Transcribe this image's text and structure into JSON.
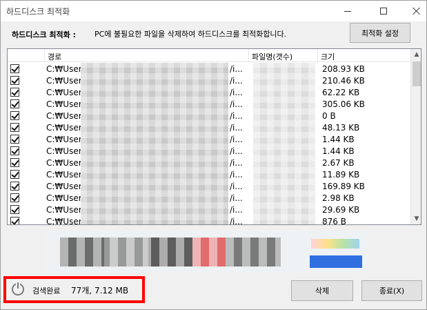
{
  "window": {
    "title": "하드디스크 최적화"
  },
  "header": {
    "label": "하드디스크 최적화 :",
    "description": "PC에 불필요한 파일을 삭제하여 하드디스크를 최적화합니다.",
    "settings_button": "최적화 설정"
  },
  "table": {
    "columns": [
      "경로",
      "파일명(갯수)",
      "크기"
    ],
    "rows": [
      {
        "checked": true,
        "path": "C:₩User",
        "frag": "/i...",
        "size": "208.93 KB"
      },
      {
        "checked": true,
        "path": "C:₩User",
        "frag": "/i...",
        "size": "210.46 KB"
      },
      {
        "checked": true,
        "path": "C:₩User",
        "frag": "/i...",
        "size": "62.22 KB"
      },
      {
        "checked": true,
        "path": "C:₩User",
        "frag": "/i...",
        "size": "305.06 KB"
      },
      {
        "checked": true,
        "path": "C:₩User",
        "frag": "/i...",
        "size": "0 B"
      },
      {
        "checked": true,
        "path": "C:₩User",
        "frag": "/i...",
        "size": "48.13 KB"
      },
      {
        "checked": true,
        "path": "C:₩User",
        "frag": "/i...",
        "size": "1.44 KB"
      },
      {
        "checked": true,
        "path": "C:₩User",
        "frag": "/i...",
        "size": "1.44 KB"
      },
      {
        "checked": true,
        "path": "C:₩User",
        "frag": "/i...",
        "size": "2.67 KB"
      },
      {
        "checked": true,
        "path": "C:₩User",
        "frag": "/i...",
        "size": "11.89 KB"
      },
      {
        "checked": true,
        "path": "C:₩User",
        "frag": "/i...",
        "size": "169.89 KB"
      },
      {
        "checked": true,
        "path": "C:₩User",
        "frag": "/i...",
        "size": "2.98 KB"
      },
      {
        "checked": true,
        "path": "C:₩User",
        "frag": "/i...",
        "size": "29.69 KB"
      },
      {
        "checked": true,
        "path": "C:₩User",
        "frag": "/i...",
        "size": "876 B"
      }
    ]
  },
  "status": {
    "label": "검색완료",
    "value": "77개, 7.12 MB",
    "icon": "power-icon",
    "highlight_color": "#ff0000"
  },
  "buttons": {
    "delete": "삭제",
    "close": "종료(X)"
  }
}
